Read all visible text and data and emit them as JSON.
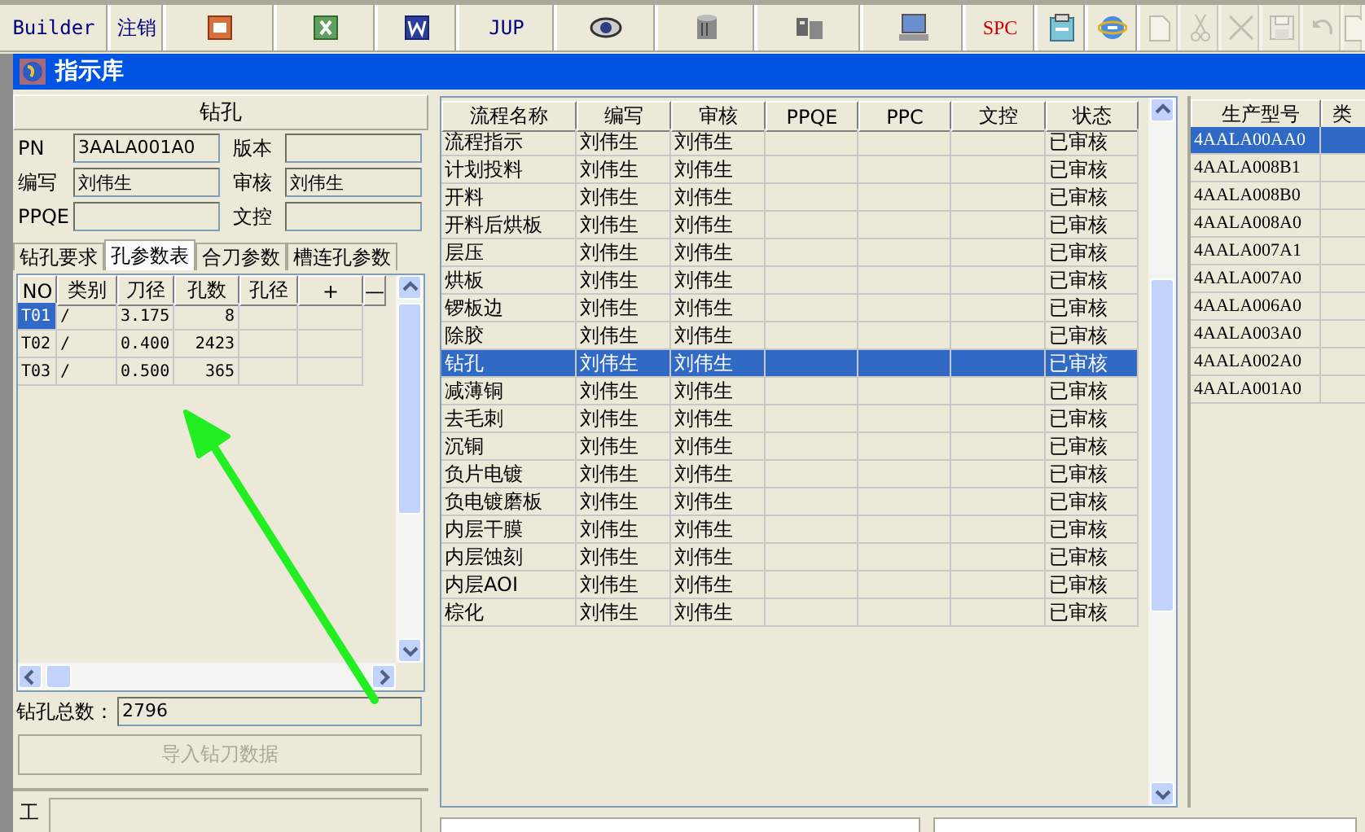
{
  "toolbar": [
    {
      "kind": "text",
      "label": "Builder",
      "disabled": false
    },
    {
      "kind": "text",
      "label": "注销",
      "disabled": false
    },
    {
      "kind": "slides",
      "disabled": false
    },
    {
      "kind": "sheet",
      "disabled": false
    },
    {
      "kind": "doc",
      "disabled": false
    },
    {
      "kind": "text",
      "label": "JUP",
      "disabled": false
    },
    {
      "kind": "eye",
      "disabled": false
    },
    {
      "kind": "database",
      "disabled": false
    },
    {
      "kind": "servers",
      "disabled": false
    },
    {
      "kind": "monitor",
      "disabled": false
    },
    {
      "kind": "spc",
      "label": "SPC",
      "disabled": false
    },
    {
      "kind": "clipboard",
      "disabled": false
    },
    {
      "kind": "globe",
      "disabled": false
    },
    {
      "kind": "page",
      "disabled": true
    },
    {
      "kind": "scissors",
      "disabled": true
    },
    {
      "kind": "cross",
      "disabled": true
    },
    {
      "kind": "disk",
      "disabled": true
    },
    {
      "kind": "undo",
      "disabled": true
    },
    {
      "kind": "page",
      "disabled": true
    }
  ],
  "window": {
    "title": "指示库"
  },
  "left": {
    "header": "钻孔",
    "fields": [
      {
        "label": "PN",
        "value": "3AALA001A0"
      },
      {
        "label": "版本"
      },
      {
        "label": "编写",
        "value": "刘伟生"
      },
      {
        "label": "审核",
        "value": "刘伟生"
      },
      {
        "label": "PPQE"
      },
      {
        "label": "文控"
      }
    ],
    "tabs": [
      {
        "label": "钻孔要求",
        "selected": false
      },
      {
        "label": "孔参数表",
        "selected": true
      },
      {
        "label": "合刀参数",
        "selected": false
      },
      {
        "label": "槽连孔参数",
        "selected": false
      }
    ],
    "grid": {
      "columns": [
        "NO",
        "类别",
        "刀径",
        "孔数",
        "孔径",
        "+",
        "—"
      ],
      "rows": [
        {
          "cells": [
            "T01",
            "/",
            "3.175",
            "8",
            "",
            ""
          ],
          "selected": true
        },
        {
          "cells": [
            "T02",
            "/",
            "0.400",
            "2423",
            "",
            ""
          ],
          "selected": false
        },
        {
          "cells": [
            "T03",
            "/",
            "0.500",
            "365",
            "",
            ""
          ],
          "selected": false
        }
      ]
    },
    "total": {
      "label": "钻孔总数：",
      "value": "2796"
    },
    "import_button": {
      "label": "导入钻刀数据",
      "disabled": true
    },
    "notes": {
      "label": "工"
    }
  },
  "table": {
    "columns": [
      "流程名称",
      "编写",
      "审核",
      "PPQE",
      "PPC",
      "文控",
      "状态"
    ],
    "rows": [
      {
        "cells": [
          "流程指示",
          "刘伟生",
          "刘伟生",
          "",
          "",
          "",
          "已审核"
        ],
        "selected": false
      },
      {
        "cells": [
          "计划投料",
          "刘伟生",
          "刘伟生",
          "",
          "",
          "",
          "已审核"
        ],
        "selected": false
      },
      {
        "cells": [
          "开料",
          "刘伟生",
          "刘伟生",
          "",
          "",
          "",
          "已审核"
        ],
        "selected": false
      },
      {
        "cells": [
          "开料后烘板",
          "刘伟生",
          "刘伟生",
          "",
          "",
          "",
          "已审核"
        ],
        "selected": false
      },
      {
        "cells": [
          "层压",
          "刘伟生",
          "刘伟生",
          "",
          "",
          "",
          "已审核"
        ],
        "selected": false
      },
      {
        "cells": [
          "烘板",
          "刘伟生",
          "刘伟生",
          "",
          "",
          "",
          "已审核"
        ],
        "selected": false
      },
      {
        "cells": [
          "锣板边",
          "刘伟生",
          "刘伟生",
          "",
          "",
          "",
          "已审核"
        ],
        "selected": false
      },
      {
        "cells": [
          "除胶",
          "刘伟生",
          "刘伟生",
          "",
          "",
          "",
          "已审核"
        ],
        "selected": false
      },
      {
        "cells": [
          "钻孔",
          "刘伟生",
          "刘伟生",
          "",
          "",
          "",
          "已审核"
        ],
        "selected": true
      },
      {
        "cells": [
          "减薄铜",
          "刘伟生",
          "刘伟生",
          "",
          "",
          "",
          "已审核"
        ],
        "selected": false
      },
      {
        "cells": [
          "去毛刺",
          "刘伟生",
          "刘伟生",
          "",
          "",
          "",
          "已审核"
        ],
        "selected": false
      },
      {
        "cells": [
          "沉铜",
          "刘伟生",
          "刘伟生",
          "",
          "",
          "",
          "已审核"
        ],
        "selected": false
      },
      {
        "cells": [
          "负片电镀",
          "刘伟生",
          "刘伟生",
          "",
          "",
          "",
          "已审核"
        ],
        "selected": false
      },
      {
        "cells": [
          "负电镀磨板",
          "刘伟生",
          "刘伟生",
          "",
          "",
          "",
          "已审核"
        ],
        "selected": false
      },
      {
        "cells": [
          "内层干膜",
          "刘伟生",
          "刘伟生",
          "",
          "",
          "",
          "已审核"
        ],
        "selected": false
      },
      {
        "cells": [
          "内层蚀刻",
          "刘伟生",
          "刘伟生",
          "",
          "",
          "",
          "已审核"
        ],
        "selected": false
      },
      {
        "cells": [
          "内层AOI",
          "刘伟生",
          "刘伟生",
          "",
          "",
          "",
          "已审核"
        ],
        "selected": false
      },
      {
        "cells": [
          "棕化",
          "刘伟生",
          "刘伟生",
          "",
          "",
          "",
          "已审核"
        ],
        "selected": false
      }
    ]
  },
  "models": {
    "columns": [
      "生产型号",
      "类"
    ],
    "rows": [
      {
        "model": "4AALA00AA0",
        "selected": true
      },
      {
        "model": "4AALA008B1",
        "selected": false
      },
      {
        "model": "4AALA008B0",
        "selected": false
      },
      {
        "model": "4AALA008A0",
        "selected": false
      },
      {
        "model": "4AALA007A1",
        "selected": false
      },
      {
        "model": "4AALA007A0",
        "selected": false
      },
      {
        "model": "4AALA006A0",
        "selected": false
      },
      {
        "model": "4AALA003A0",
        "selected": false
      },
      {
        "model": "4AALA002A0",
        "selected": false
      },
      {
        "model": "4AALA001A0",
        "selected": false
      }
    ]
  }
}
